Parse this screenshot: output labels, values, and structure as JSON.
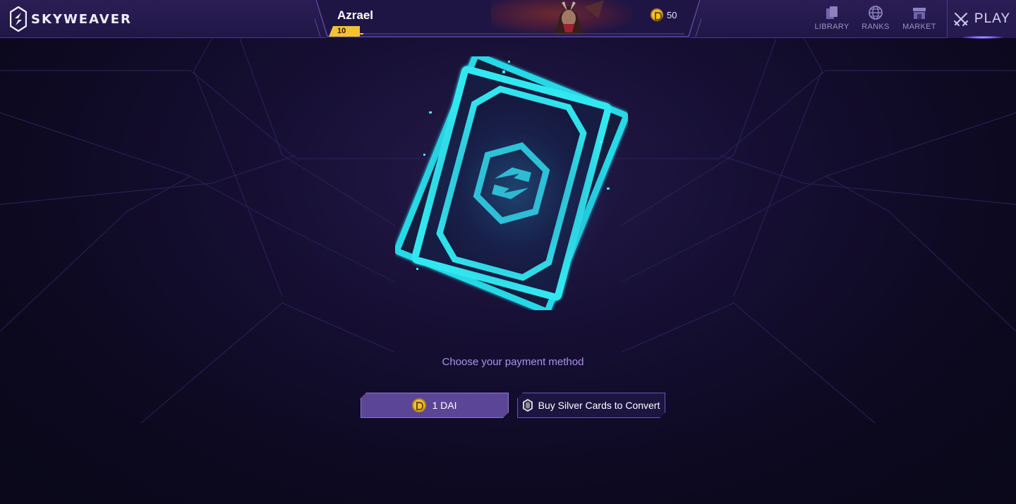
{
  "app": {
    "name": "SKYWEAVER"
  },
  "profile": {
    "player_name": "Azrael",
    "level": "10",
    "xp_progress": 0.01,
    "coin_balance": "50"
  },
  "nav": {
    "items": [
      {
        "label": "LIBRARY",
        "icon": "library-icon"
      },
      {
        "label": "RANKS",
        "icon": "globe-icon"
      },
      {
        "label": "MARKET",
        "icon": "market-icon"
      }
    ],
    "play_label": "PLAY"
  },
  "main": {
    "prompt": "Choose your payment method",
    "pay_dai_label": "1 DAI",
    "pay_silver_label": "Buy Silver Cards to Convert"
  },
  "colors": {
    "accent": "#f2c230",
    "pack_glow": "#22e6ef",
    "primary_button": "#5b4596"
  }
}
